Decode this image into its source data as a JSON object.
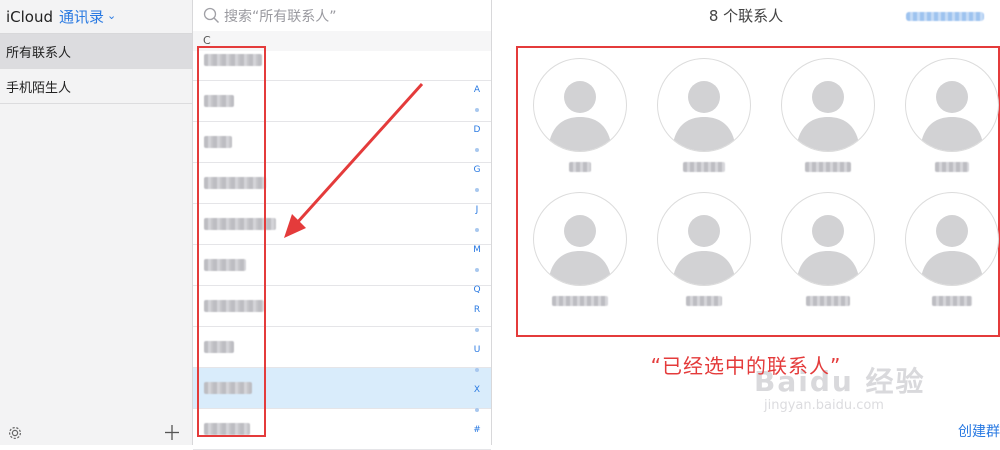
{
  "groups": {
    "brand": "iCloud",
    "app_name": "通讯录",
    "items": [
      {
        "label": "所有联系人",
        "selected": true
      },
      {
        "label": "手机陌生人",
        "selected": false
      }
    ]
  },
  "list": {
    "search_placeholder": "搜索“所有联系人”",
    "section_letter": "C",
    "rows": [
      {
        "name_width": 58,
        "selected": false
      },
      {
        "name_width": 30,
        "selected": false
      },
      {
        "name_width": 28,
        "selected": false
      },
      {
        "name_width": 62,
        "selected": false
      },
      {
        "name_width": 72,
        "selected": false
      },
      {
        "name_width": 42,
        "selected": false
      },
      {
        "name_width": 60,
        "selected": false
      },
      {
        "name_width": 30,
        "selected": false
      },
      {
        "name_width": 48,
        "selected": true
      },
      {
        "name_width": 46,
        "selected": false
      }
    ],
    "index": [
      "A",
      "•",
      "D",
      "•",
      "G",
      "•",
      "J",
      "•",
      "M",
      "•",
      "Q",
      "R",
      "•",
      "U",
      "•",
      "X",
      "•",
      "#"
    ]
  },
  "detail": {
    "title": "8 个联系人",
    "cards": [
      {
        "name_width": 22
      },
      {
        "name_width": 42
      },
      {
        "name_width": 46
      },
      {
        "name_width": 34
      },
      {
        "name_width": 56
      },
      {
        "name_width": 36
      },
      {
        "name_width": 44
      },
      {
        "name_width": 40
      }
    ],
    "caption": "“已经选中的联系人”",
    "create_link": "创建群",
    "watermark": "Baidu 经验",
    "watermark_sub": "jingyan.baidu.com"
  },
  "colors": {
    "accent": "#2a7ae2",
    "annotation": "#e43b3b",
    "selected_row": "#d9ecfb"
  },
  "icons": {
    "settings": "gear-icon",
    "add": "plus-icon",
    "search": "search-icon",
    "dropdown": "chevron-down-icon"
  }
}
